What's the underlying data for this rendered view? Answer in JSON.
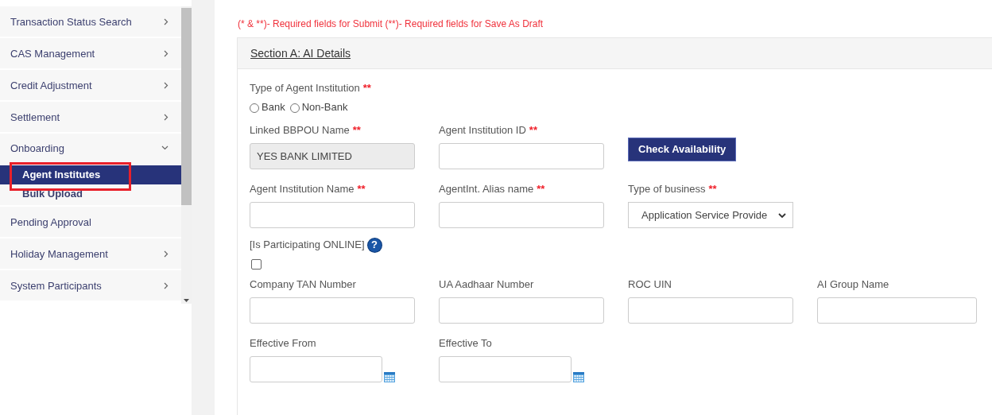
{
  "sidebar": {
    "items": [
      {
        "label": "Transaction Status Search",
        "kind": "menu",
        "expanded": false
      },
      {
        "label": "CAS Management",
        "kind": "menu",
        "expanded": false
      },
      {
        "label": "Credit Adjustment",
        "kind": "menu",
        "expanded": false
      },
      {
        "label": "Settlement",
        "kind": "menu",
        "expanded": false
      },
      {
        "label": "Onboarding",
        "kind": "menu",
        "expanded": true,
        "children": [
          {
            "label": "Agent Institutes",
            "selected": true,
            "annotated": true
          },
          {
            "label": "Bulk Upload",
            "selected": false,
            "annotated": false
          }
        ]
      },
      {
        "label": "Pending Approval",
        "kind": "link"
      },
      {
        "label": "Holiday Management",
        "kind": "menu",
        "expanded": false
      },
      {
        "label": "System Participants",
        "kind": "menu",
        "expanded": false
      }
    ]
  },
  "form": {
    "note": "(* & **)- Required fields for Submit (**)- Required fields for Save As Draft",
    "section_title": "Section A: AI Details",
    "rows": [
      {
        "fields": [
          {
            "kind": "radio",
            "label": "Type of Agent Institution",
            "required_mark": "**",
            "options": [
              {
                "label": "Bank",
                "selected": false
              },
              {
                "label": "Non-Bank",
                "selected": false
              }
            ]
          }
        ]
      },
      {
        "fields": [
          {
            "kind": "text",
            "label": "Linked BBPOU Name",
            "required_mark": "**",
            "value": "YES BANK LIMITED",
            "disabled": true
          },
          {
            "kind": "text",
            "label": "Agent Institution ID",
            "required_mark": "**",
            "disabled": false
          },
          {
            "kind": "button",
            "label": "Check Availability"
          }
        ]
      },
      {
        "fields": [
          {
            "kind": "text",
            "label": "Agent Institution Name",
            "required_mark": "**",
            "disabled": false
          },
          {
            "kind": "text",
            "label": "AgentInt. Alias name",
            "required_mark": "**",
            "disabled": false
          },
          {
            "kind": "select",
            "label": "Type of business",
            "required_mark": "**",
            "value": "Application Service Provide"
          }
        ]
      },
      {
        "fields": [
          {
            "kind": "checkbox",
            "label": "[Is Participating ONLINE]",
            "help": "?",
            "checked": false
          }
        ]
      },
      {
        "fields": [
          {
            "kind": "text",
            "label": "Company TAN Number",
            "disabled": false
          },
          {
            "kind": "text",
            "label": "UA Aadhaar Number",
            "disabled": false
          },
          {
            "kind": "text",
            "label": "ROC UIN",
            "disabled": false
          },
          {
            "kind": "text",
            "label": "AI Group Name",
            "disabled": false
          }
        ]
      },
      {
        "fields": [
          {
            "kind": "date",
            "label": "Effective From"
          },
          {
            "kind": "date",
            "label": "Effective To"
          }
        ]
      }
    ]
  }
}
